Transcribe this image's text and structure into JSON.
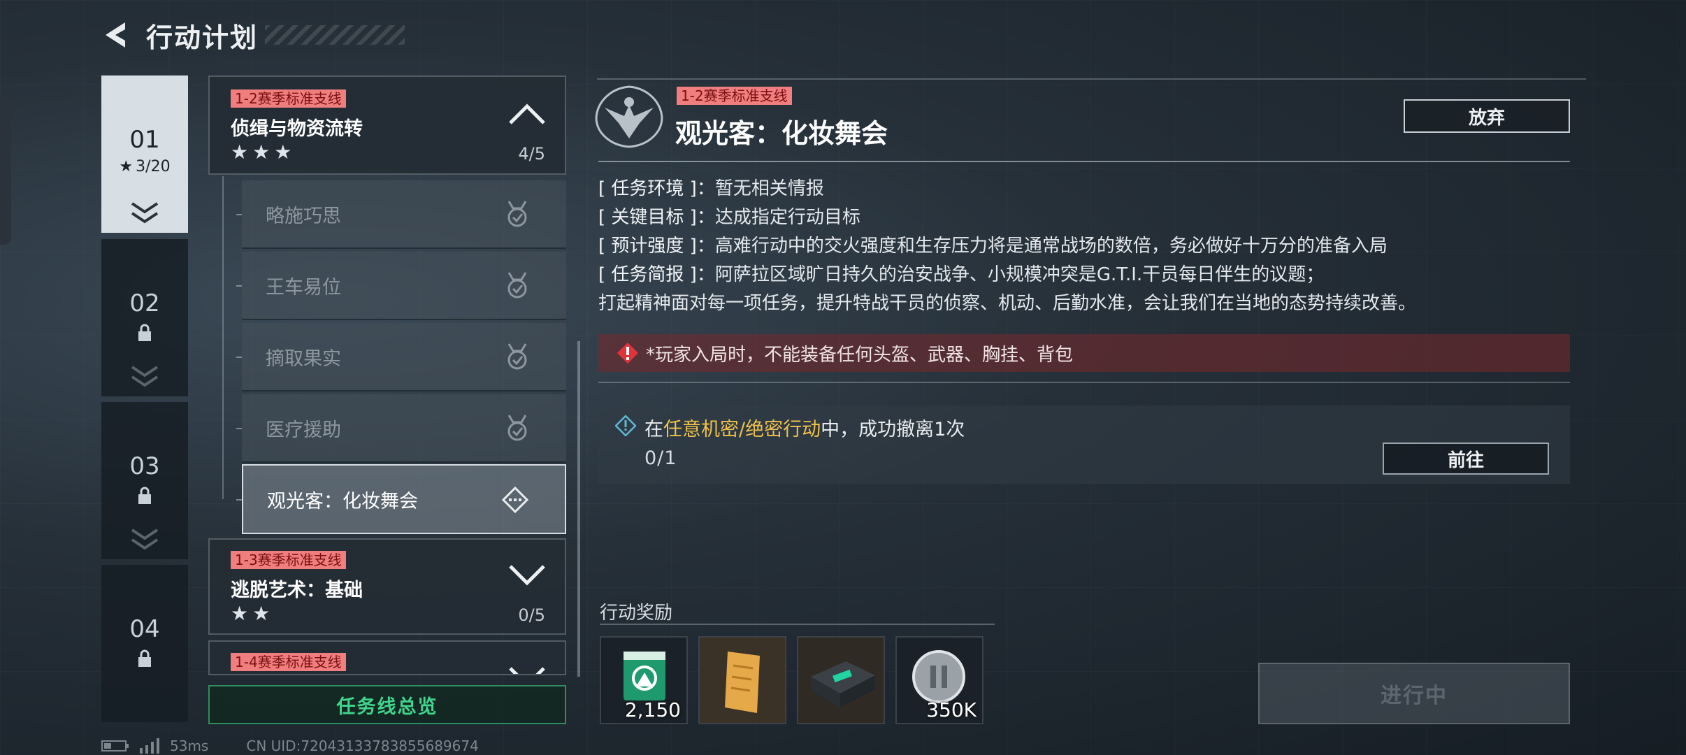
{
  "header": {
    "title": "行动计划"
  },
  "seasons": [
    {
      "num": "01",
      "stars": "3/20",
      "locked": false
    },
    {
      "num": "02",
      "locked": true
    },
    {
      "num": "03",
      "locked": true
    },
    {
      "num": "04",
      "locked": true
    }
  ],
  "groups": [
    {
      "badge": "1-2赛季标准支线",
      "title": "侦缉与物资流转",
      "stars": "★★★",
      "progress": "4/5"
    },
    {
      "badge": "1-3赛季标准支线",
      "title": "逃脱艺术：基础",
      "stars": "★★",
      "progress": "0/5"
    },
    {
      "badge": "1-4赛季标准支线"
    }
  ],
  "sub_missions": [
    "略施巧思",
    "王车易位",
    "摘取果实",
    "医疗援助",
    "观光客：化妆舞会"
  ],
  "overview_button": "任务线总览",
  "status": {
    "ping": "53ms",
    "uid": "CN UID:72043133783855689674"
  },
  "detail": {
    "badge": "1-2赛季标准支线",
    "title": "观光客：化妆舞会",
    "abandon": "放弃",
    "info": [
      {
        "key": "[ 任务环境 ]：",
        "val": "暂无相关情报"
      },
      {
        "key": "[ 关键目标 ]：",
        "val": "达成指定行动目标"
      },
      {
        "key": "[ 预计强度 ]：",
        "val": "高难行动中的交火强度和生存压力将是通常战场的数倍，务必做好十万分的准备入局"
      },
      {
        "key": "[ 任务简报 ]：",
        "val": "阿萨拉区域旷日持久的治安战争、小规模冲突是G.T.I.干员每日伴生的议题；"
      }
    ],
    "info_extra": "打起精神面对每一项任务，提升特战干员的侦察、机动、后勤水准，会让我们在当地的态势持续改善。",
    "warning": "*玩家入局时，不能装备任何头盔、武器、胸挂、背包",
    "task": {
      "pre": "在",
      "highlight": "任意机密/绝密行动",
      "post": "中，成功撤离1次",
      "count": "0/1",
      "goto": "前往"
    },
    "reward_label": "行动奖励",
    "rewards": [
      {
        "icon": "green-token-icon",
        "qty": "2,150"
      },
      {
        "icon": "document-icon",
        "qty": ""
      },
      {
        "icon": "device-case-icon",
        "qty": ""
      },
      {
        "icon": "silver-coin-icon",
        "qty": "350K"
      }
    ],
    "status_button": "进行中"
  },
  "colors": {
    "badge": "#f07e7e",
    "highlight": "#f2c24a",
    "green": "#3fd68c",
    "warning_bg": "#78282c"
  }
}
